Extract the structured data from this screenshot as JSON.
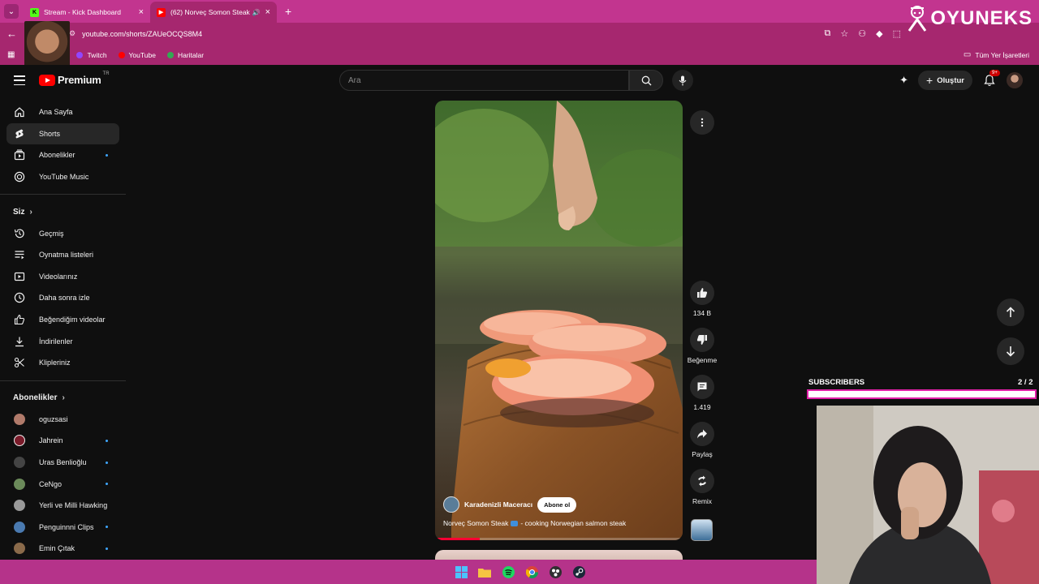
{
  "browser": {
    "tabs": [
      {
        "title": "Stream - Kick Dashboard",
        "favicon": "kick-icon",
        "active": false
      },
      {
        "title": "(62) Norveç Somon Steak",
        "favicon": "youtube-icon",
        "active": true
      }
    ],
    "url": "youtube.com/shorts/ZAUeOCQS8M4",
    "bookmarks": [
      {
        "label": "Twitch",
        "color": "#9146ff"
      },
      {
        "label": "YouTube",
        "color": "#ff0000"
      },
      {
        "label": "Haritalar",
        "color": "#34a853"
      }
    ],
    "all_bookmarks": "Tüm Yer İşaretleri",
    "theme_color": "#c2358f"
  },
  "overlay_logo": "OYUNEKS",
  "youtube": {
    "brand": "Premium",
    "region": "TR",
    "search_placeholder": "Ara",
    "create_label": "Oluştur",
    "notification_badge": "9+"
  },
  "sidebar": {
    "main": [
      {
        "label": "Ana Sayfa",
        "icon": "home-icon",
        "active": false,
        "dot": false
      },
      {
        "label": "Shorts",
        "icon": "shorts-icon",
        "active": true,
        "dot": false
      },
      {
        "label": "Abonelikler",
        "icon": "subscriptions-icon",
        "active": false,
        "dot": true
      },
      {
        "label": "YouTube Music",
        "icon": "music-icon",
        "active": false,
        "dot": false
      }
    ],
    "you_heading": "Siz",
    "you": [
      {
        "label": "Geçmiş",
        "icon": "history-icon"
      },
      {
        "label": "Oynatma listeleri",
        "icon": "playlists-icon"
      },
      {
        "label": "Videolarınız",
        "icon": "your-videos-icon"
      },
      {
        "label": "Daha sonra izle",
        "icon": "watch-later-icon"
      },
      {
        "label": "Beğendiğim videolar",
        "icon": "liked-icon"
      },
      {
        "label": "İndirilenler",
        "icon": "downloads-icon"
      },
      {
        "label": "Klipleriniz",
        "icon": "clips-icon"
      }
    ],
    "subs_heading": "Abonelikler",
    "subscriptions": [
      {
        "label": "oguzsasi",
        "color": "#b07a6a",
        "dot": false
      },
      {
        "label": "Jahrein",
        "color": "#7a1b2a",
        "dot": true
      },
      {
        "label": "Uras Benlioğlu",
        "color": "#444444",
        "dot": true
      },
      {
        "label": "CeNgo",
        "color": "#6b8a5a",
        "dot": true
      },
      {
        "label": "Yerli ve Milli Hawking",
        "color": "#999999",
        "dot": false
      },
      {
        "label": "Penguinnni Clips",
        "color": "#4a7ab0",
        "dot": true
      },
      {
        "label": "Emin Çıtak",
        "color": "#8a6a4a",
        "dot": true
      }
    ]
  },
  "short": {
    "channel": "Karadenizli Maceracı",
    "subscribe_label": "Abone ol",
    "title_prefix": "Norveç Somon Steak",
    "title_suffix": "- cooking Norwegian salmon steak",
    "progress": 0.18,
    "likes": "134 B",
    "dislike_label": "Beğenme",
    "comments": "1.419",
    "share_label": "Paylaş",
    "remix_label": "Remix"
  },
  "stream_overlay": {
    "subs_label": "SUBSCRIBERS",
    "subs_count": "2 / 2",
    "subs_progress": 1.0,
    "accent": "#e020a8"
  },
  "taskbar_icons": [
    "windows-icon",
    "file-explorer-icon",
    "spotify-icon",
    "chrome-icon",
    "obs-icon",
    "steam-icon"
  ]
}
